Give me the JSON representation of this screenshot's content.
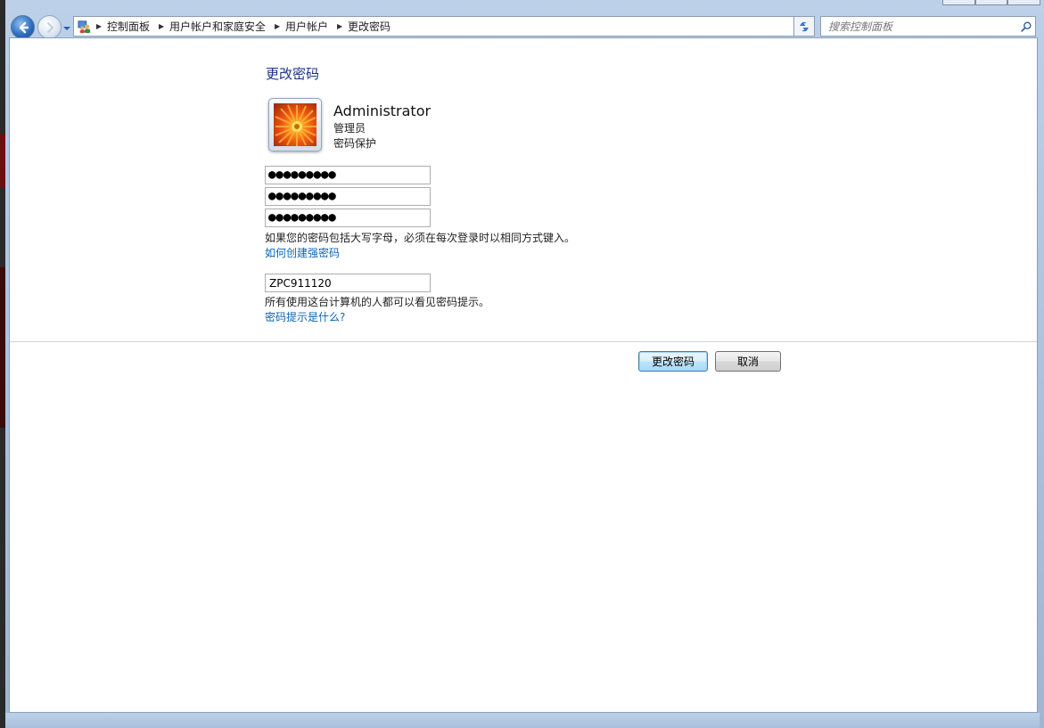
{
  "address_bar": {
    "breadcrumbs": [
      "控制面板",
      "用户帐户和家庭安全",
      "用户帐户",
      "更改密码"
    ]
  },
  "search": {
    "placeholder": "搜索控制面板"
  },
  "page": {
    "title": "更改密码"
  },
  "user": {
    "name": "Administrator",
    "role": "管理员",
    "status": "密码保护"
  },
  "fields": {
    "current_password": "●●●●●●●●●",
    "new_password": "●●●●●●●●●",
    "confirm_password": "●●●●●●●●●",
    "password_note": "如果您的密码包括大写字母，必须在每次登录时以相同方式键入。",
    "strong_password_link": "如何创建强密码",
    "hint_value": "ZPC911120",
    "hint_note": "所有使用这台计算机的人都可以看见密码提示。",
    "hint_link": "密码提示是什么?"
  },
  "buttons": {
    "change_password": "更改密码",
    "cancel": "取消"
  },
  "colors": {
    "title": "#1e3287",
    "link": "#0a64b4"
  }
}
